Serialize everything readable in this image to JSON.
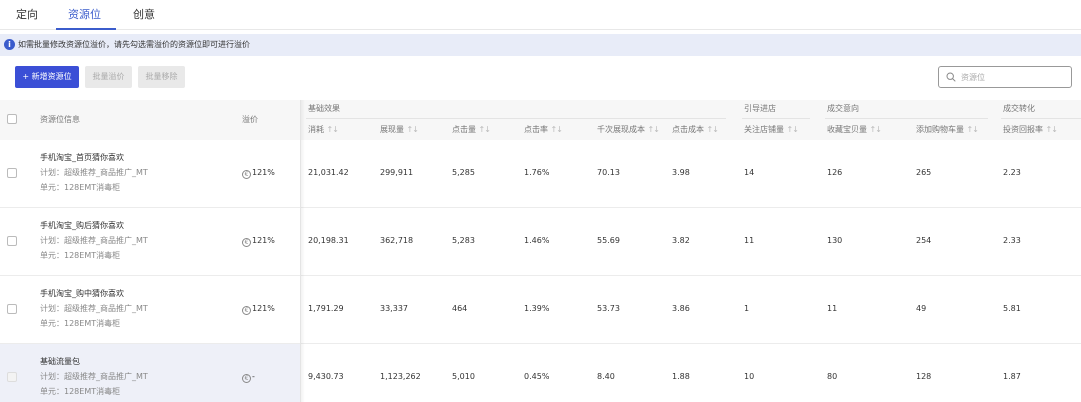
{
  "tabs": [
    {
      "label": "定向"
    },
    {
      "label": "资源位"
    },
    {
      "label": "创意"
    }
  ],
  "active_tab": 1,
  "notice": {
    "icon": "info-icon",
    "text": "如需批量修改资源位溢价，请先勾选需溢价的资源位即可进行溢价"
  },
  "toolbar": {
    "add_label": "+ 新增资源位",
    "batch_premium_label": "批量溢价",
    "batch_remove_label": "批量移除"
  },
  "search": {
    "placeholder": "资源位"
  },
  "table": {
    "col_info": "资源位信息",
    "col_bid": "溢价",
    "groups": [
      {
        "label": "基础效果"
      },
      {
        "label": "引导进店"
      },
      {
        "label": "成交意向"
      },
      {
        "label": "成交转化"
      }
    ],
    "metrics": [
      {
        "label": "消耗"
      },
      {
        "label": "展现量"
      },
      {
        "label": "点击量"
      },
      {
        "label": "点击率"
      },
      {
        "label": "千次展现成本"
      },
      {
        "label": "点击成本"
      },
      {
        "label": "关注店铺量"
      },
      {
        "label": "收藏宝贝量"
      },
      {
        "label": "添加购物车量"
      },
      {
        "label": "投资回报率"
      }
    ],
    "rows": [
      {
        "name": "手机淘宝_首页猜你喜欢",
        "plan": "计划：超级推荐_商品推广_MT",
        "unit": "单元：128EMT消毒柜",
        "bid": "121%",
        "values": [
          "21,031.42",
          "299,911",
          "5,285",
          "1.76%",
          "70.13",
          "3.98",
          "14",
          "126",
          "265",
          "2.23"
        ]
      },
      {
        "name": "手机淘宝_购后猜你喜欢",
        "plan": "计划：超级推荐_商品推广_MT",
        "unit": "单元：128EMT消毒柜",
        "bid": "121%",
        "values": [
          "20,198.31",
          "362,718",
          "5,283",
          "1.46%",
          "55.69",
          "3.82",
          "11",
          "130",
          "254",
          "2.33"
        ]
      },
      {
        "name": "手机淘宝_购中猜你喜欢",
        "plan": "计划：超级推荐_商品推广_MT",
        "unit": "单元：128EMT消毒柜",
        "bid": "121%",
        "values": [
          "1,791.29",
          "33,337",
          "464",
          "1.39%",
          "53.73",
          "3.86",
          "1",
          "11",
          "49",
          "5.81"
        ]
      },
      {
        "name": "基础流量包",
        "plan": "计划：超级推荐_商品推广_MT",
        "unit": "单元：128EMT消毒柜",
        "bid": "-",
        "values": [
          "9,430.73",
          "1,123,262",
          "5,010",
          "0.45%",
          "8.40",
          "1.88",
          "10",
          "80",
          "128",
          "1.87"
        ]
      }
    ]
  },
  "colors": {
    "accent": "#3b5ccc",
    "primary_button": "#3b4fd6",
    "notice_bg": "#e8ecf8",
    "highlight_row": "#eef0f8"
  }
}
